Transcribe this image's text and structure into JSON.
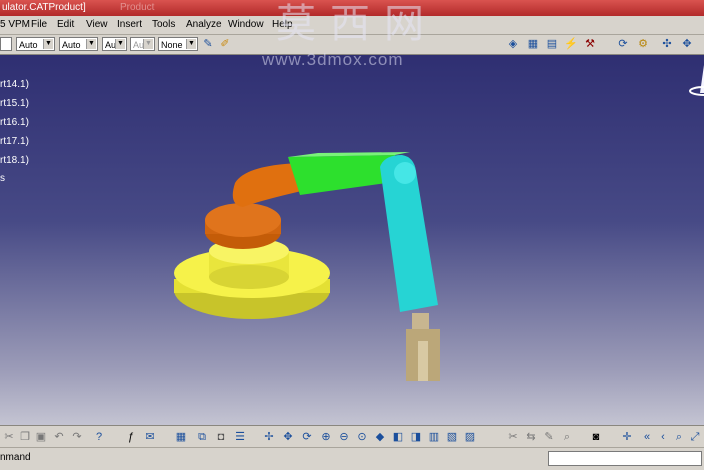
{
  "window": {
    "title": "ulator.CATProduct]",
    "ghost_title": "Product"
  },
  "menu": {
    "items": [
      "5 VPM",
      "File",
      "Edit",
      "View",
      "Insert",
      "Tools",
      "Analyze",
      "Window",
      "Help"
    ]
  },
  "watermark": {
    "cn": "莫西网",
    "url": "www.3dmox.com"
  },
  "properties": {
    "combos": [
      {
        "value": "",
        "disabled": false
      },
      {
        "value": "Auto",
        "disabled": false
      },
      {
        "value": "Auto",
        "disabled": false
      },
      {
        "value": "Aut",
        "disabled": false
      },
      {
        "value": "Aut",
        "disabled": true
      },
      {
        "value": "None",
        "disabled": false
      }
    ]
  },
  "tree": {
    "nodes": [
      "rt14.1)",
      "rt15.1)",
      "rt16.1)",
      "rt17.1)",
      "rt18.1)",
      "s"
    ]
  },
  "status": {
    "text": "nmand"
  },
  "colors": {
    "base": "#f3f03c",
    "shoulder": "#e06d0c",
    "upper_arm": "#2fe02f",
    "forearm": "#22d6d6",
    "gripper": "#c2b08a"
  },
  "icons": {
    "top_right": [
      "catalog-icon",
      "table-icon",
      "grid-icon",
      "bolt-icon",
      "hammer-icon",
      "rotate-icon",
      "gear-icon",
      "compass-icon",
      "pan-icon"
    ],
    "bottom": [
      "cut-icon",
      "copy-icon",
      "paste-icon",
      "undo-icon",
      "redo-icon",
      "help-icon",
      "formula-icon",
      "comment-icon",
      "table-icon",
      "tree-icon",
      "lock-icon",
      "params-icon",
      "fit-all-icon",
      "pan-icon",
      "rotate-icon",
      "zoom-in-icon",
      "zoom-out-icon",
      "normal-view-icon",
      "cube-icon",
      "iso-view-icon",
      "render-icon",
      "hide-icon",
      "show-icon",
      "scissors-icon",
      "measure-icon",
      "camera-icon",
      "target-icon",
      "arrows-icon",
      "search-icon",
      "edit-icon"
    ]
  }
}
